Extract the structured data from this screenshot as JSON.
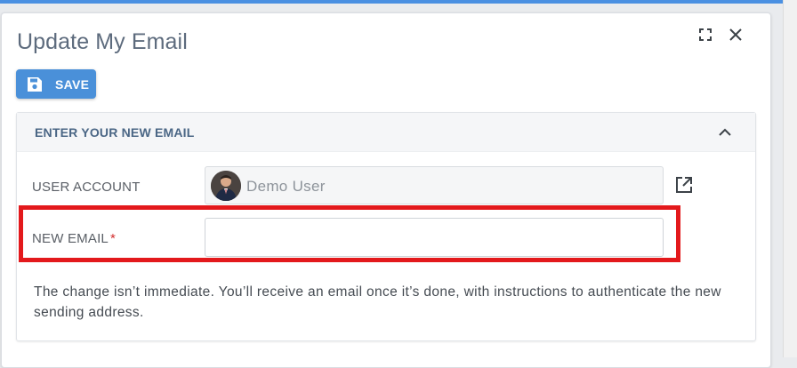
{
  "dialog": {
    "title": "Update My Email",
    "maximize_icon": "maximize-icon",
    "close_icon": "close-icon"
  },
  "toolbar": {
    "save_label": "SAVE",
    "save_icon": "save-icon",
    "save_color": "#4a90d9"
  },
  "panel": {
    "title": "ENTER YOUR NEW EMAIL",
    "collapse_icon": "chevron-up-icon",
    "title_color": "#4a6685"
  },
  "form": {
    "user_account_label": "USER ACCOUNT",
    "user_account_value": "Demo User",
    "open_icon": "open-in-new-icon",
    "new_email_label": "NEW EMAIL",
    "required_mark": "*",
    "new_email_value": "",
    "highlight_color": "#e3191c"
  },
  "note": "The change isn’t immediate. You’ll receive an email once it’s done, with instructions to authenticate the new sending address."
}
